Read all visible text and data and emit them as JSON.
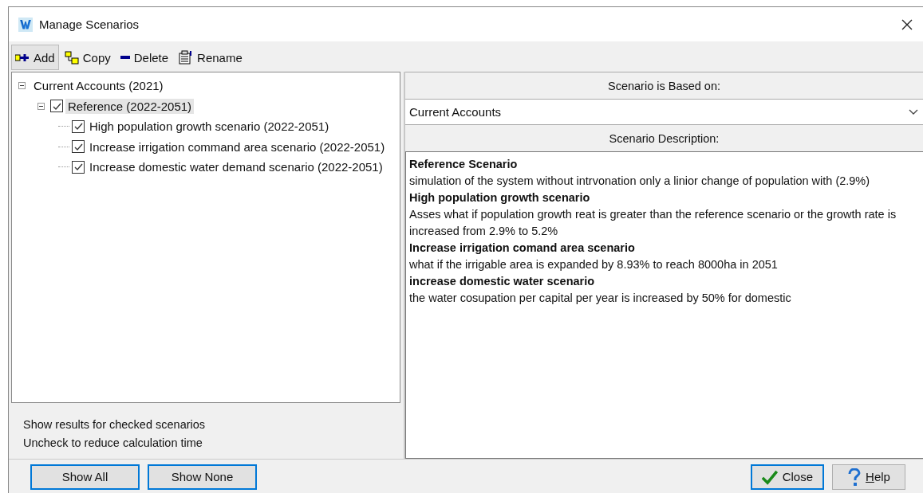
{
  "window": {
    "title": "Manage Scenarios"
  },
  "toolbar": [
    {
      "kind": "add",
      "label": "Add",
      "selected": true
    },
    {
      "kind": "copy",
      "label": "Copy",
      "selected": false
    },
    {
      "kind": "delete",
      "label": "Delete",
      "selected": false
    },
    {
      "kind": "rename",
      "label": "Rename",
      "selected": false
    }
  ],
  "tree": [
    {
      "label": "Current Accounts (2021)",
      "expanded": true,
      "selected": false,
      "children": [
        {
          "label": "Reference (2022-2051)",
          "checked": true,
          "expanded": true,
          "selected": true,
          "children": [
            {
              "label": "High population growth scenario (2022-2051)",
              "checked": true,
              "selected": false
            },
            {
              "label": "Increase irrigation command area scenario (2022-2051)",
              "checked": true,
              "selected": false
            },
            {
              "label": "Increase domestic water demand scenario (2022-2051)",
              "checked": true,
              "selected": false
            }
          ]
        }
      ]
    }
  ],
  "notes": [
    "Show results for checked scenarios",
    "Uncheck to reduce calculation time"
  ],
  "based_on": {
    "heading": "Scenario is Based on:",
    "value": "Current Accounts"
  },
  "description": {
    "heading": "Scenario Description:",
    "lines": [
      {
        "kind": "heading",
        "text": "Reference Scenario"
      },
      {
        "kind": "text",
        "text": "simulation of the system without intrvonation only a linior change of population with (2.9%)"
      },
      {
        "kind": "heading",
        "text": "High population growth scenario"
      },
      {
        "kind": "text",
        "text": "Asses what if population growth reat is greater than the reference scenario or the growth rate is increased from 2.9% to 5.2%"
      },
      {
        "kind": "heading",
        "text": "Increase irrigation comand area scenario"
      },
      {
        "kind": "text",
        "text": "what if the irrigable area is expanded by 8.93% to reach 8000ha in 2051"
      },
      {
        "kind": "heading",
        "text": "increase domestic water scenario"
      },
      {
        "kind": "text",
        "text": "the water cosupation per capital per year is increased by 50% for domestic"
      }
    ]
  },
  "left_buttons": [
    {
      "label": "Show All",
      "focused": true
    },
    {
      "label": "Show None",
      "focused": true
    }
  ],
  "right_buttons": [
    {
      "kind": "close",
      "label": "Close",
      "focused": true
    },
    {
      "kind": "help",
      "accelerator": "H",
      "label_rest": "elp",
      "focused": false
    }
  ]
}
